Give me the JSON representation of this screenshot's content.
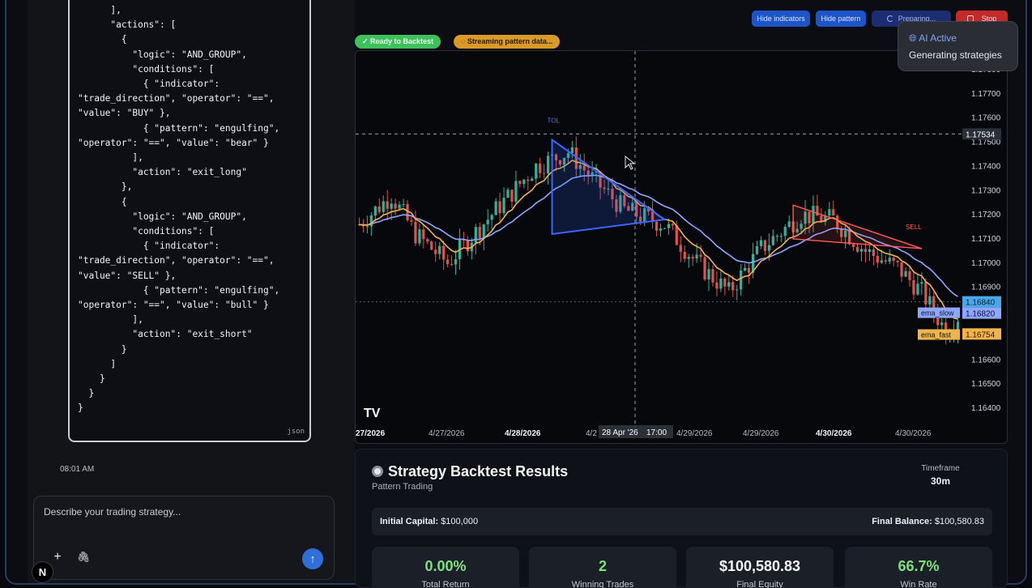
{
  "code": {
    "lines": [
      "      ],",
      "      \"actions\": [",
      "        {",
      "          \"logic\": \"AND_GROUP\",",
      "          \"conditions\": [",
      "            { \"indicator\":",
      "\"trade_direction\", \"operator\": \"==\",",
      "\"value\": \"BUY\" },",
      "            { \"pattern\": \"engulfing\",",
      "\"operator\": \"==\", \"value\": \"bear\" }",
      "          ],",
      "          \"action\": \"exit_long\"",
      "        },",
      "        {",
      "          \"logic\": \"AND_GROUP\",",
      "          \"conditions\": [",
      "            { \"indicator\":",
      "\"trade_direction\", \"operator\": \"==\",",
      "\"value\": \"SELL\" },",
      "            { \"pattern\": \"engulfing\",",
      "\"operator\": \"==\", \"value\": \"bull\" }",
      "          ],",
      "          \"action\": \"exit_short\"",
      "        }",
      "      ]",
      "    }",
      "  }",
      "}"
    ],
    "language": "json",
    "timestamp": "08:01 AM"
  },
  "composer": {
    "placeholder": "Describe your trading strategy...",
    "plus_icon": "plus-icon",
    "attach_icon": "paperclip-icon",
    "send_icon": "arrow-up-icon"
  },
  "badge": "N",
  "toolbar": {
    "hide_indicators": "Hide indicators",
    "hide_pattern": "Hide pattern",
    "preparing": "Preparing...",
    "stop": "Stop"
  },
  "status": {
    "ready": "✓ Ready to Backtest",
    "streaming": "◌ Streaming pattern data..."
  },
  "ai_toast": {
    "title": "AI Active",
    "subtitle": "Generating strategies",
    "icon": "globe-icon"
  },
  "chart_data": {
    "type": "candlestick",
    "y_ticks": [
      "1.17800",
      "1.17700",
      "1.17600",
      "1.17500",
      "1.17400",
      "1.17300",
      "1.17200",
      "1.17100",
      "1.17000",
      "1.16900",
      "1.16800",
      "1.16700",
      "1.16600",
      "1.16500",
      "1.16400"
    ],
    "ylim": [
      1.1635,
      1.1785
    ],
    "x_ticks": [
      "27/2026",
      "4/27/2026",
      "4/28/2026",
      "4/2",
      "4/29/2026",
      "4/29/2026",
      "4/30/2026",
      "4/30/2026"
    ],
    "crosshair_time": "28 Apr '26",
    "crosshair_hour": "17:00",
    "crosshair_price": "1.17534",
    "last_price": "1.16840",
    "series": [
      {
        "name": "ema_slow",
        "value": "1.16820",
        "color": "#8fa6ff"
      },
      {
        "name": "ema_fast",
        "value": "1.16754",
        "color": "#f0b44a"
      }
    ],
    "pattern_labels": [
      "TOL",
      "SELL"
    ],
    "logo": "TV",
    "colors": {
      "up": "#2fb39a",
      "down": "#e0524a",
      "pattern_blue": "#3a66ff",
      "pattern_red": "#ff5a5a"
    }
  },
  "results": {
    "title": "Strategy Backtest Results",
    "subtitle": "Pattern Trading",
    "timeframe_label": "Timeframe",
    "timeframe_value": "30m",
    "initial_capital_label": "Initial Capital:",
    "initial_capital_value": "$100,000",
    "final_balance_label": "Final Balance:",
    "final_balance_value": "$100,580.83",
    "stats": [
      {
        "value": "0.00%",
        "label": "Total Return",
        "color": "#7fe07f"
      },
      {
        "value": "2",
        "label": "Winning Trades",
        "color": "#7fe07f"
      },
      {
        "value": "$100,580.83",
        "label": "Final Equity",
        "color": "#f4f5f8"
      },
      {
        "value": "66.7%",
        "label": "Win Rate",
        "color": "#7fe07f"
      }
    ]
  }
}
